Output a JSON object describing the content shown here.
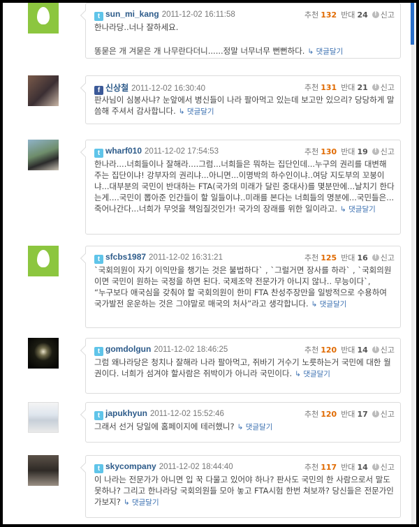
{
  "labels": {
    "up": "추천",
    "down": "반대",
    "report": "신고",
    "reply": "댓글달기"
  },
  "comments": [
    {
      "user": "sun_mi_kang",
      "sns": "twitter-icon",
      "date": "2011-12-02 16:11:58",
      "up": "132",
      "down": "24",
      "lines": [
        "한나라당..너나 잘하세요.",
        "",
        "똥묻은 개 겨묻은 개 나무란다더니......정말 너무너무 뻔뻔하다."
      ]
    },
    {
      "user": "신상철",
      "sns": "facebook-icon",
      "date": "2011-12-02 16:30:40",
      "up": "131",
      "down": "21",
      "lines": [
        "판사님이 심봉사냐? 눈앞에서 병신들이 나라 팔아먹고 있는데 보고만 있으리? 당당하게 말씀해 주셔서 감사합니다."
      ]
    },
    {
      "user": "wharf010",
      "sns": "twitter-icon",
      "date": "2011-12-02 17:54:53",
      "up": "130",
      "down": "19",
      "lines": [
        "한나라....너희들이나 잘해라....그럼...너희들은 뭐하는 집단인데...누구의 권리를 대변해 주는 집단이냐! 강부자의 권리냐...아니면...이명박의 하수인이냐..여당 지도부의 꼬붕이냐...대부분의 국민이 반대하는 FTA(국가의 미래가 달린 중대사)를 몇분만에...날치기 한다는게....국민이 뽑아준 인간들이 할 일들이냐..미래를 본다는 너희들의 명분에...국민들은...죽어나간다...너희가 무엇을 책임질것인가! 국가의 장래를 위한 일이라고."
      ]
    },
    {
      "user": "sfcbs1987",
      "sns": "twitter-icon",
      "date": "2011-12-02 16:31:21",
      "up": "125",
      "down": "16",
      "lines": [
        "`국회의원이 자기 이익만을 챙기는 것은 불법하다` , `그럴거면 장사를 하라` , `국회의원이면 국민이 원하는 국정을 하면 된다. 국제조약 전문가가 아니지 않나.. 무능이다`,",
        "“누구보다 애국심을 갖춰야 할 국회의원이 한미 FTA 찬성주장만을 일방적으로 수용하여 국가발전 운운하는 것은 그야말로 매국의 처사”라고 생각합니다."
      ]
    },
    {
      "user": "gomdolgun",
      "sns": "twitter-icon",
      "date": "2011-12-02 18:46:25",
      "up": "120",
      "down": "14",
      "lines": [
        "그럼 왜나라당은 청치나 잘해라 나라 팔아먹고, 쥐바기 거수기 노릇하는거 국민에 대한 월권이다. 너희가 섬겨야 할사람은 쥐박이가 아니라 국민이다."
      ]
    },
    {
      "user": "japukhyun",
      "sns": "twitter-icon",
      "date": "2011-12-02 15:52:46",
      "up": "120",
      "down": "17",
      "lines": [
        "그래서 선거 당일에 홈페이지에 테러했니?"
      ]
    },
    {
      "user": "skycompany",
      "sns": "twitter-icon",
      "date": "2011-12-02 18:44:40",
      "up": "117",
      "down": "14",
      "lines": [
        "이 나라는 전문가가 아니면 입 꾹 다물고 있어야 하나? 판사도 국민의 한 사람으로서 말도 못하나? 그리고 한나라당 국회의원들 모아 놓고 FTA시험 한번 쳐보까? 당신들은 전문가인가보지?"
      ]
    }
  ]
}
